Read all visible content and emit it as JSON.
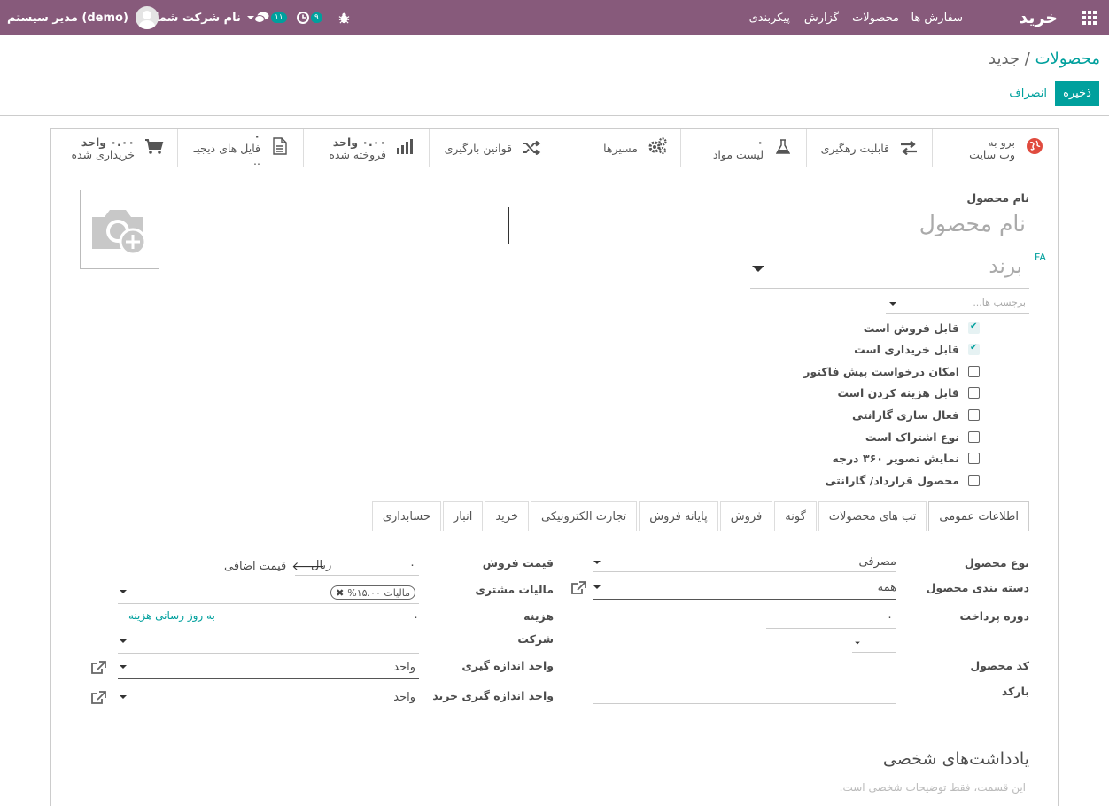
{
  "topbar": {
    "brand": "خرید",
    "menu": [
      "سفارش ها",
      "محصولات",
      "گزارش",
      "پیکربندی"
    ],
    "activity_count": "۹",
    "messages_count": "۱۱",
    "company": "نام شرکت شما",
    "user": "مدیر سیستم (demo)",
    "icons": [
      "apps-icon",
      "bug-icon",
      "clock-icon",
      "chat-icon"
    ]
  },
  "breadcrumb": {
    "parent": "محصولات",
    "separator": "/",
    "current": "جدید"
  },
  "actions": {
    "save": "ذخیره",
    "discard": "انصراف"
  },
  "buttonbox": [
    {
      "icon": "globe-icon",
      "line1": "برو به",
      "line2": "وب سایت"
    },
    {
      "icon": "exchange-icon",
      "line1": "قابلیت رهگیری",
      "line2": ""
    },
    {
      "icon": "flask-icon",
      "line1": "۰",
      "line2": "لیست مواد"
    },
    {
      "icon": "cogs-icon",
      "line1": "مسیرها",
      "line2": ""
    },
    {
      "icon": "random-icon",
      "line1": "قوانین بارگیری",
      "line2": ""
    },
    {
      "icon": "bar-chart-icon",
      "line1": "۰.۰۰ واحد",
      "line2": "فروخته شده"
    },
    {
      "icon": "file-icon",
      "line1": "۰",
      "line2": "فایل های دیجیـ .."
    },
    {
      "icon": "cart-icon",
      "line1": "۰.۰۰ واحد",
      "line2": "خریداری شده"
    }
  ],
  "form": {
    "name_label": "نام محصول",
    "name_placeholder": "نام محصول",
    "lang": "FA",
    "brand_placeholder": "برند",
    "tags_placeholder": "برچسب ها...",
    "checkboxes": [
      {
        "label": "قابل فروش است",
        "checked": true
      },
      {
        "label": "قابل خریداری است",
        "checked": true
      },
      {
        "label": "امکان درخواست پیش فاکتور",
        "checked": false
      },
      {
        "label": "قابل هزینه کردن است",
        "checked": false
      },
      {
        "label": "فعال سازی گارانتی",
        "checked": false
      },
      {
        "label": "نوع اشتراک است",
        "checked": false
      },
      {
        "label": "نمایش تصویر ۳۶۰ درجه",
        "checked": false
      },
      {
        "label": "محصول قرارداد/ گارانتی",
        "checked": false
      }
    ]
  },
  "tabs": [
    "اطلاعات عمومی",
    "تب های محصولات",
    "گونه",
    "فروش",
    "پایانه فروش",
    "تجارت الکترونیکی",
    "خرید",
    "انبار",
    "حسابداری"
  ],
  "general": {
    "product_type_label": "نوع محصول",
    "product_type_value": "مصرفی",
    "category_label": "دسته بندی محصول",
    "category_value": "همه",
    "payment_period_label": "دوره پرداخت",
    "payment_period_value": "۰",
    "code_label": "کد محصول",
    "barcode_label": "بارکد",
    "sale_price_label": "قیمت فروش",
    "sale_price_value": "۰",
    "currency": "ریال",
    "extra_price": "قیمت اضافی",
    "customer_tax_label": "مالیات مشتری",
    "tax_tag": "مالیات ۱۵.۰۰%",
    "cost_label": "هزینه",
    "cost_value": "۰",
    "update_cost": "به روز رسانی هزینه",
    "company_label": "شرکت",
    "uom_label": "واحد اندازه گیری",
    "uom_value": "واحد",
    "purchase_uom_label": "واحد اندازه گیری خرید",
    "purchase_uom_value": "واحد"
  },
  "notes": {
    "title": "یادداشت‌های شخصی",
    "placeholder": "این قسمت، فقط توضیحات شخصی است."
  }
}
